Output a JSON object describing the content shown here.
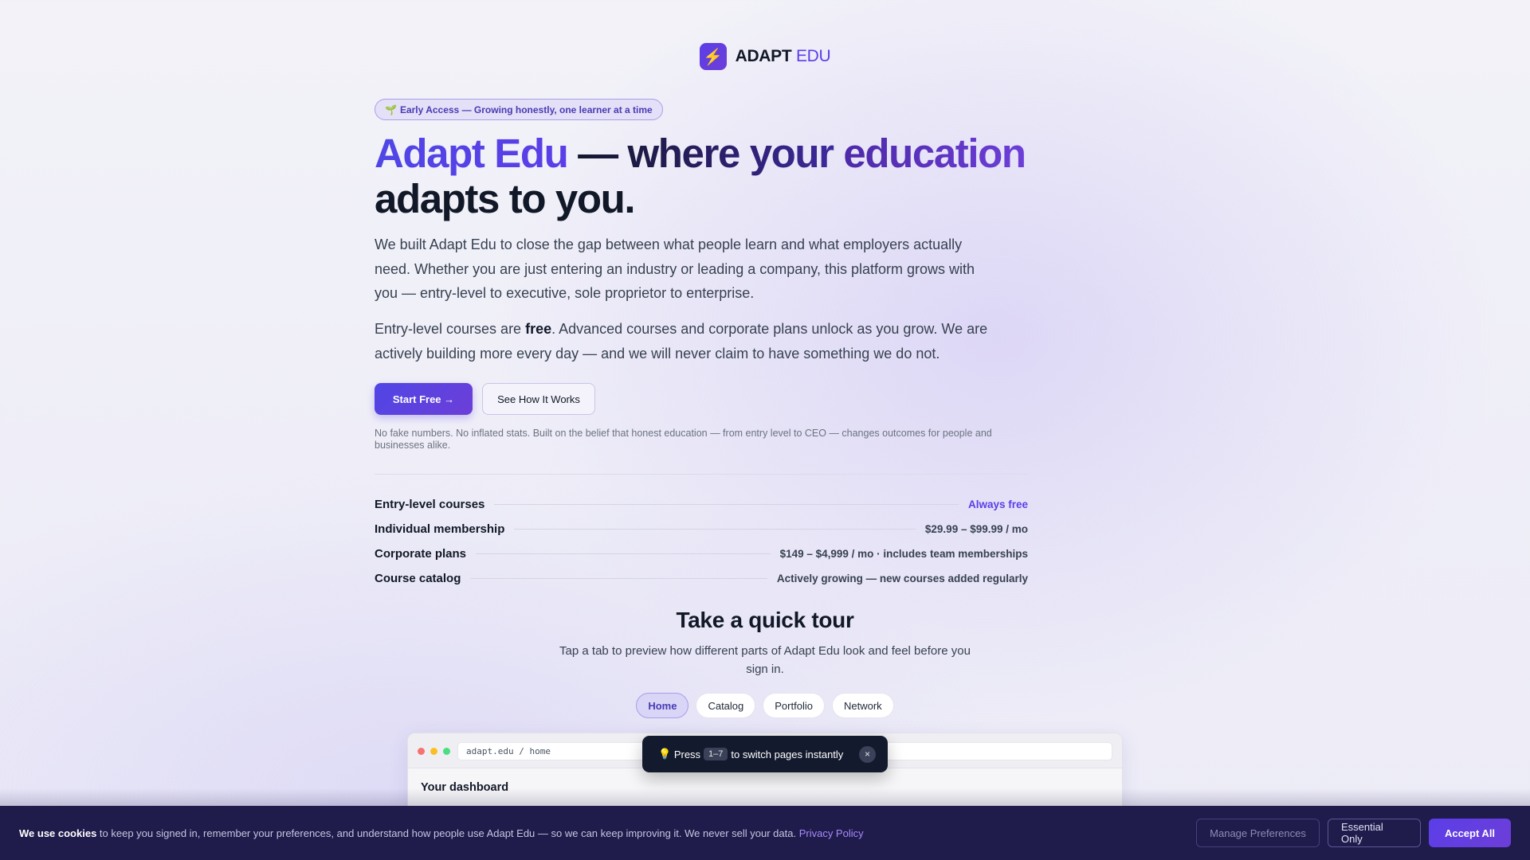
{
  "header": {
    "logo_icon": "lightning-icon",
    "logo_word1": "ADAPT",
    "logo_word2": "EDU"
  },
  "hero": {
    "badge_icon": "🌱",
    "badge": "Early Access — Growing honestly, one learner at a time",
    "headline_brand": "Adapt Edu",
    "headline_mid": " — where your ",
    "headline_edu": "education",
    "headline_tail": "adapts to you.",
    "para1": "We built Adapt Edu to close the gap between what people learn and what employers actually need. Whether you are just entering an industry or leading a company, this platform grows with you — entry-level to executive, sole proprietor to enterprise.",
    "para2_a": "Entry-level courses are ",
    "para2_bold": "free",
    "para2_b": ". Advanced courses and corporate plans unlock as you grow. We are actively building more every day — and we will never claim to have something we do not.",
    "cta_primary": "Start Free →",
    "cta_secondary": "See How It Works",
    "disclaimer": "No fake numbers. No inflated stats. Built on the belief that honest education — from entry level to CEO — changes outcomes for people and businesses alike."
  },
  "facts": [
    {
      "label": "Entry-level courses",
      "value": "Always free"
    },
    {
      "label": "Individual membership",
      "value": "$29.99 – $99.99 / mo"
    },
    {
      "label": "Corporate plans",
      "value": "$149 – $4,999 / mo · includes team memberships"
    },
    {
      "label": "Course catalog",
      "value": "Actively growing — new courses added regularly"
    }
  ],
  "tour": {
    "title": "Take a quick tour",
    "subtitle": "Tap a tab to preview how different parts of Adapt Edu look and feel before you sign in.",
    "tabs": [
      {
        "label": "Home",
        "active": true
      },
      {
        "label": "Catalog",
        "active": false
      },
      {
        "label": "Portfolio",
        "active": false
      },
      {
        "label": "Network",
        "active": false
      }
    ],
    "preview_url": "adapt.edu / home",
    "preview_heading": "Your dashboard"
  },
  "toast": {
    "icon": "💡",
    "text_before": "Press",
    "key": "1–7",
    "text_after": "to switch pages instantly",
    "close": "×"
  },
  "cookie": {
    "bold": "We use cookies",
    "text": " to keep you signed in, remember your preferences, and understand how people use Adapt Edu — so we can keep improving it. We never sell your data. ",
    "link": "Privacy Policy",
    "manage": "Manage Preferences",
    "essential": "Essential Only",
    "accept": "Accept All"
  },
  "colors": {
    "accent": "#5b3ee8",
    "cookie_bg": "#1f1b4b",
    "toast_bg": "#141a2e"
  }
}
